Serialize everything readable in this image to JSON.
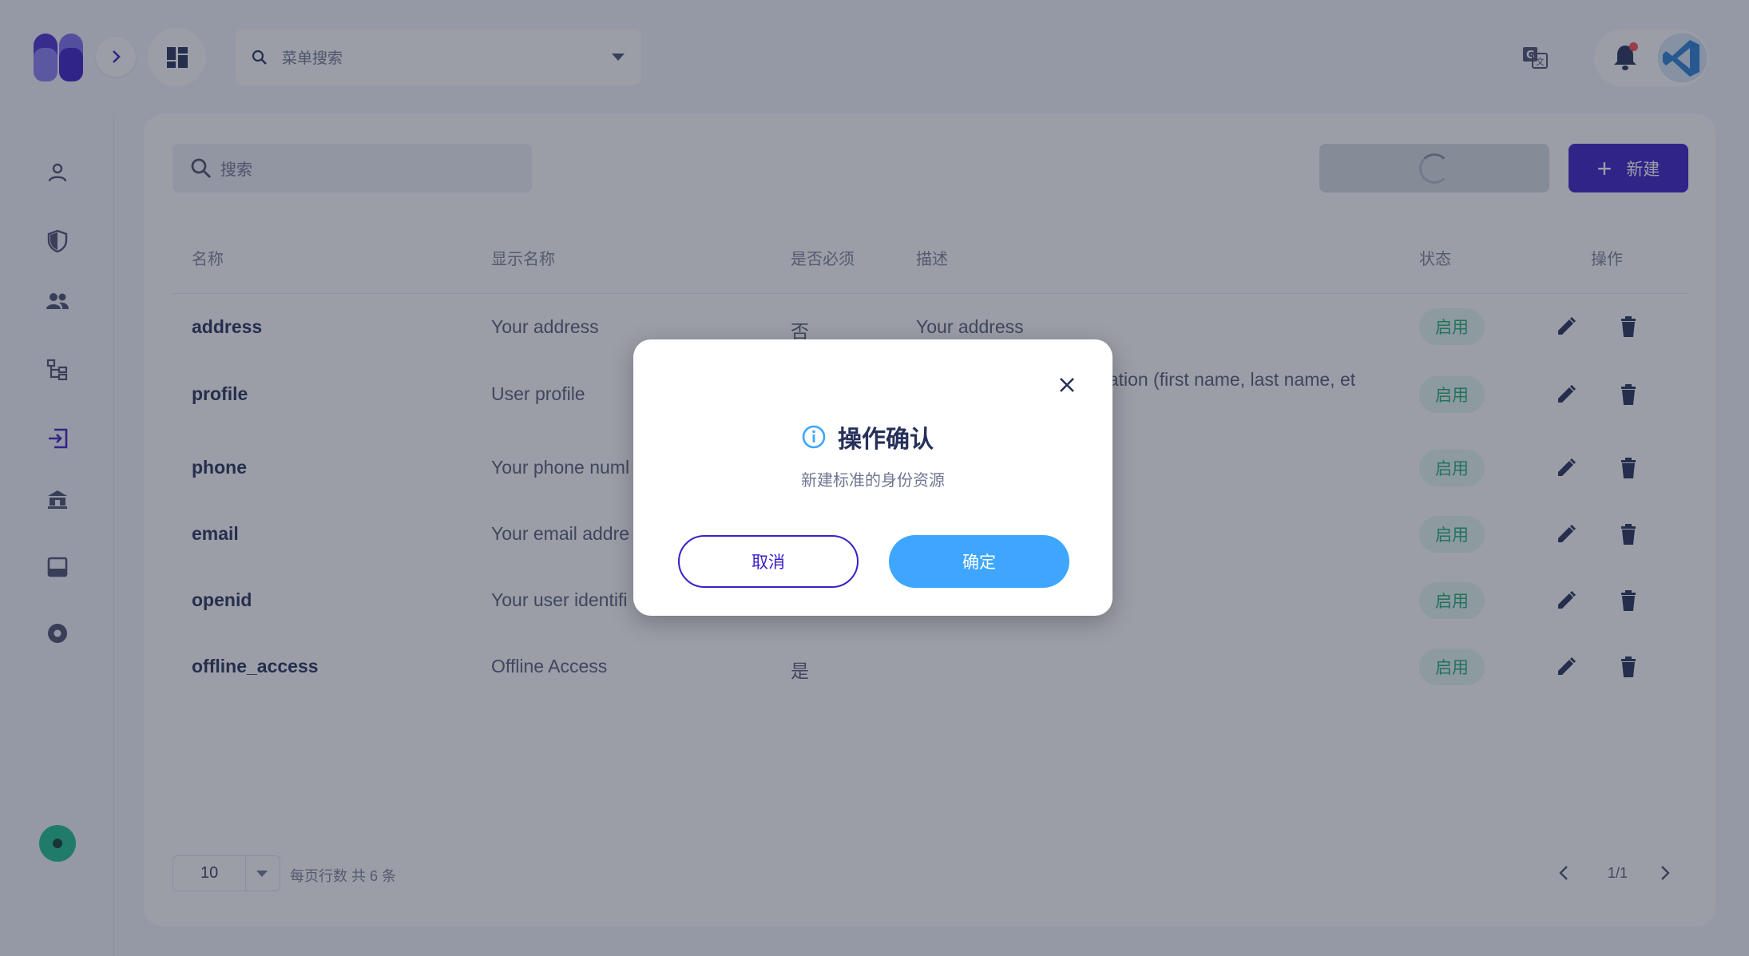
{
  "header": {
    "menu_search_placeholder": "菜单搜索"
  },
  "toolbar": {
    "search_placeholder": "搜索",
    "new_label": "新建"
  },
  "table": {
    "columns": [
      "名称",
      "显示名称",
      "是否必须",
      "描述",
      "状态",
      "操作"
    ],
    "rows": [
      {
        "name": "address",
        "display": "Your address",
        "required": "否",
        "description": "Your address",
        "status": "启用"
      },
      {
        "name": "profile",
        "display": "User profile",
        "required": "",
        "description": "nation (first name, last name, et",
        "status": "启用"
      },
      {
        "name": "phone",
        "display": "Your phone numl",
        "required": "",
        "description": "",
        "status": "启用"
      },
      {
        "name": "email",
        "display": "Your email addre",
        "required": "",
        "description": "",
        "status": "启用"
      },
      {
        "name": "openid",
        "display": "Your user identifi",
        "required": "",
        "description": "",
        "status": "启用"
      },
      {
        "name": "offline_access",
        "display": "Offline Access",
        "required": "是",
        "description": "",
        "status": "启用"
      }
    ]
  },
  "pagination": {
    "rows_per_page": "10",
    "rows_label": "每页行数  共 6 条",
    "page_info": "1/1"
  },
  "dialog": {
    "title": "操作确认",
    "message": "新建标准的身份资源",
    "cancel_label": "取消",
    "confirm_label": "确定"
  },
  "colors": {
    "brand": "#3b1fc7",
    "confirm": "#3ea6ff",
    "status_enabled": "#1fae79"
  }
}
